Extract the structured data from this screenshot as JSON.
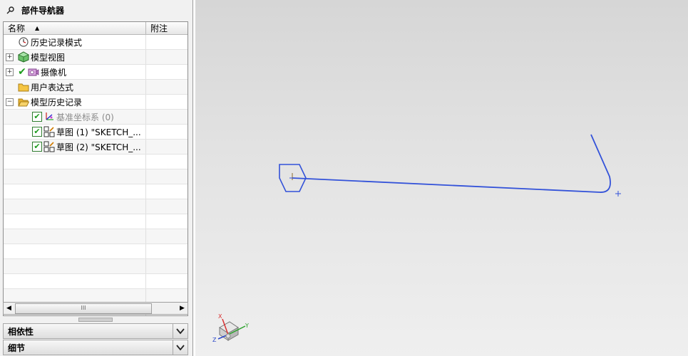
{
  "navigator": {
    "title": "部件导航器",
    "columns": {
      "name": "名称",
      "note": "附注"
    },
    "nodes": [
      {
        "label": "历史记录模式",
        "icon": "clock-icon"
      },
      {
        "label": "模型视图",
        "icon": "model-views-icon",
        "expander": "+"
      },
      {
        "label": "摄像机",
        "icon": "camera-icon",
        "expander": "+"
      },
      {
        "label": "用户表达式",
        "icon": "folder-icon"
      },
      {
        "label": "模型历史记录",
        "icon": "open-folder-icon",
        "expander": "−"
      },
      {
        "label": "基准坐标系 (0)",
        "icon": "datum-csys-icon",
        "checked": true
      },
      {
        "label": "草图 (1) \"SKETCH_...",
        "icon": "sketch-icon",
        "checked": true
      },
      {
        "label": "草图 (2) \"SKETCH_...",
        "icon": "sketch-icon",
        "checked": true
      }
    ],
    "scrollbar": {
      "thumb_grip": "III"
    }
  },
  "sections": {
    "dependencies": "相依性",
    "details": "细节"
  },
  "triad": {
    "x": "X",
    "y": "Y",
    "z": "Z"
  },
  "colors": {
    "curve": "#3352d9",
    "check": "#1e9c1e",
    "triad_x": "#d83030",
    "triad_y": "#2aa12a",
    "triad_z": "#2b47c9"
  }
}
